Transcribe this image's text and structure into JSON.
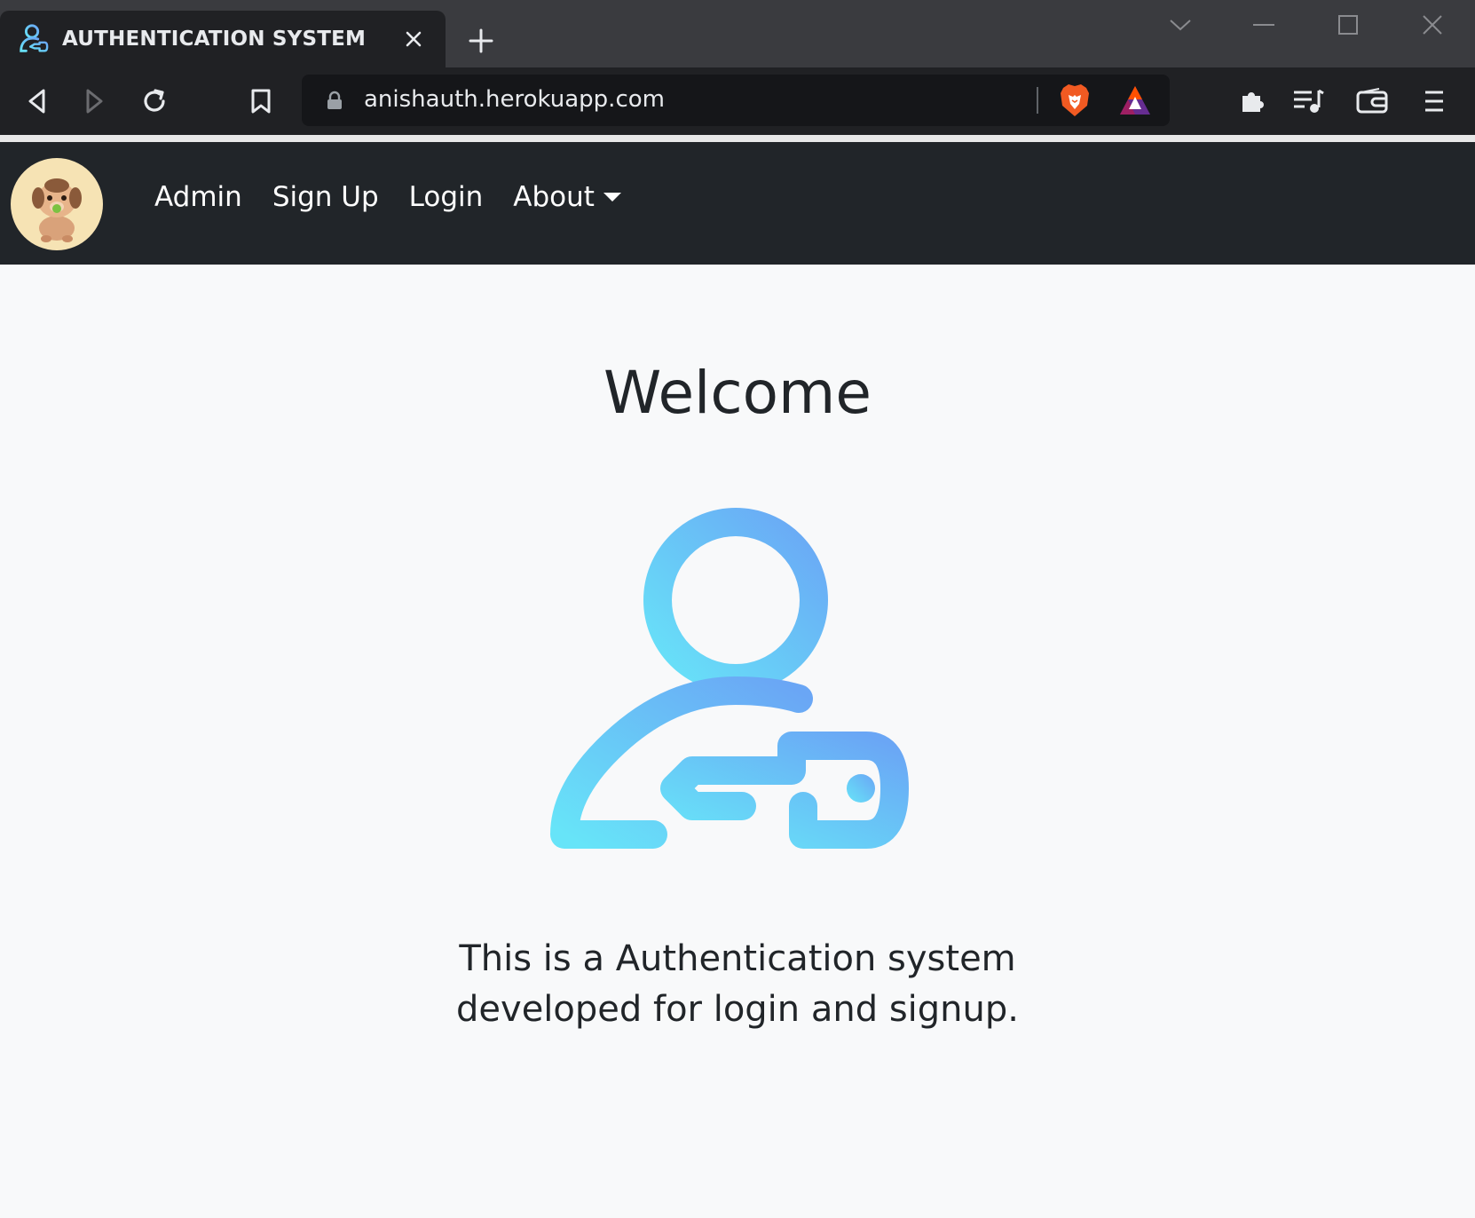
{
  "browser": {
    "tab_title": "AUTHENTICATION SYSTEM",
    "url": "anishauth.herokuapp.com"
  },
  "navbar": {
    "links": [
      {
        "label": "Admin"
      },
      {
        "label": "Sign Up"
      },
      {
        "label": "Login"
      },
      {
        "label": "About"
      }
    ]
  },
  "main": {
    "heading": "Welcome",
    "description_line1": "This is a Authentication system",
    "description_line2": "developed for login and signup."
  },
  "colors": {
    "navbar_bg": "#212529",
    "page_bg": "#f8f9fa",
    "icon_gradient_start": "#67e4f8",
    "icon_gradient_end": "#6aa6f5"
  },
  "icons": [
    "user-key-icon",
    "lock-icon",
    "brave-icon",
    "bat-icon",
    "extensions-icon",
    "playlist-icon",
    "wallet-icon",
    "menu-icon"
  ]
}
